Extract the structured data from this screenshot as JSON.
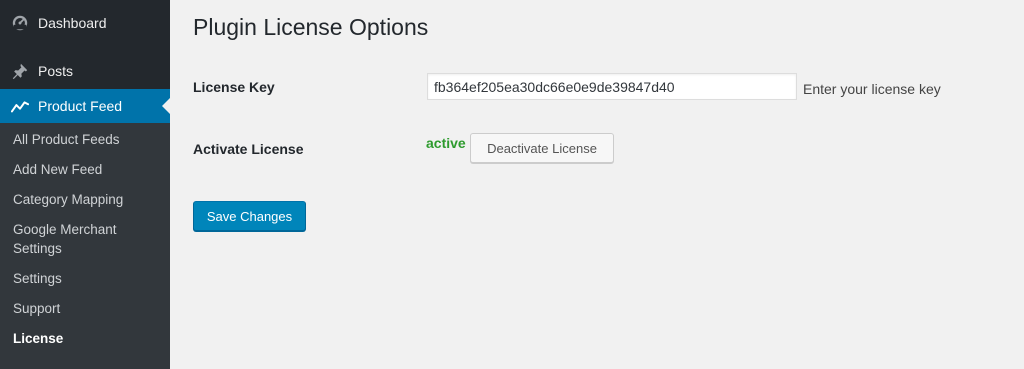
{
  "sidebar": {
    "menu": [
      {
        "label": "Dashboard",
        "icon": "dashboard-icon"
      },
      {
        "label": "Posts",
        "icon": "pushpin-icon"
      },
      {
        "label": "Product Feed",
        "icon": "chart-line-icon",
        "active": true
      }
    ],
    "submenu": [
      {
        "label": "All Product Feeds"
      },
      {
        "label": "Add New Feed"
      },
      {
        "label": "Category Mapping"
      },
      {
        "label": "Google Merchant Settings"
      },
      {
        "label": "Settings"
      },
      {
        "label": "Support"
      },
      {
        "label": "License",
        "current": true
      }
    ]
  },
  "main": {
    "title": "Plugin License Options",
    "license_key": {
      "label": "License Key",
      "value": "fb364ef205ea30dc66e0e9de39847d40",
      "description": "Enter your license key"
    },
    "activate_license": {
      "label": "Activate License",
      "status": "active",
      "button_label": "Deactivate License"
    },
    "save_button_label": "Save Changes"
  },
  "colors": {
    "sidebar_bg": "#23282d",
    "submenu_bg": "#32373c",
    "accent": "#0073aa",
    "primary_button": "#0085ba",
    "status_active": "#2e9b2e",
    "content_bg": "#f1f1f1"
  }
}
